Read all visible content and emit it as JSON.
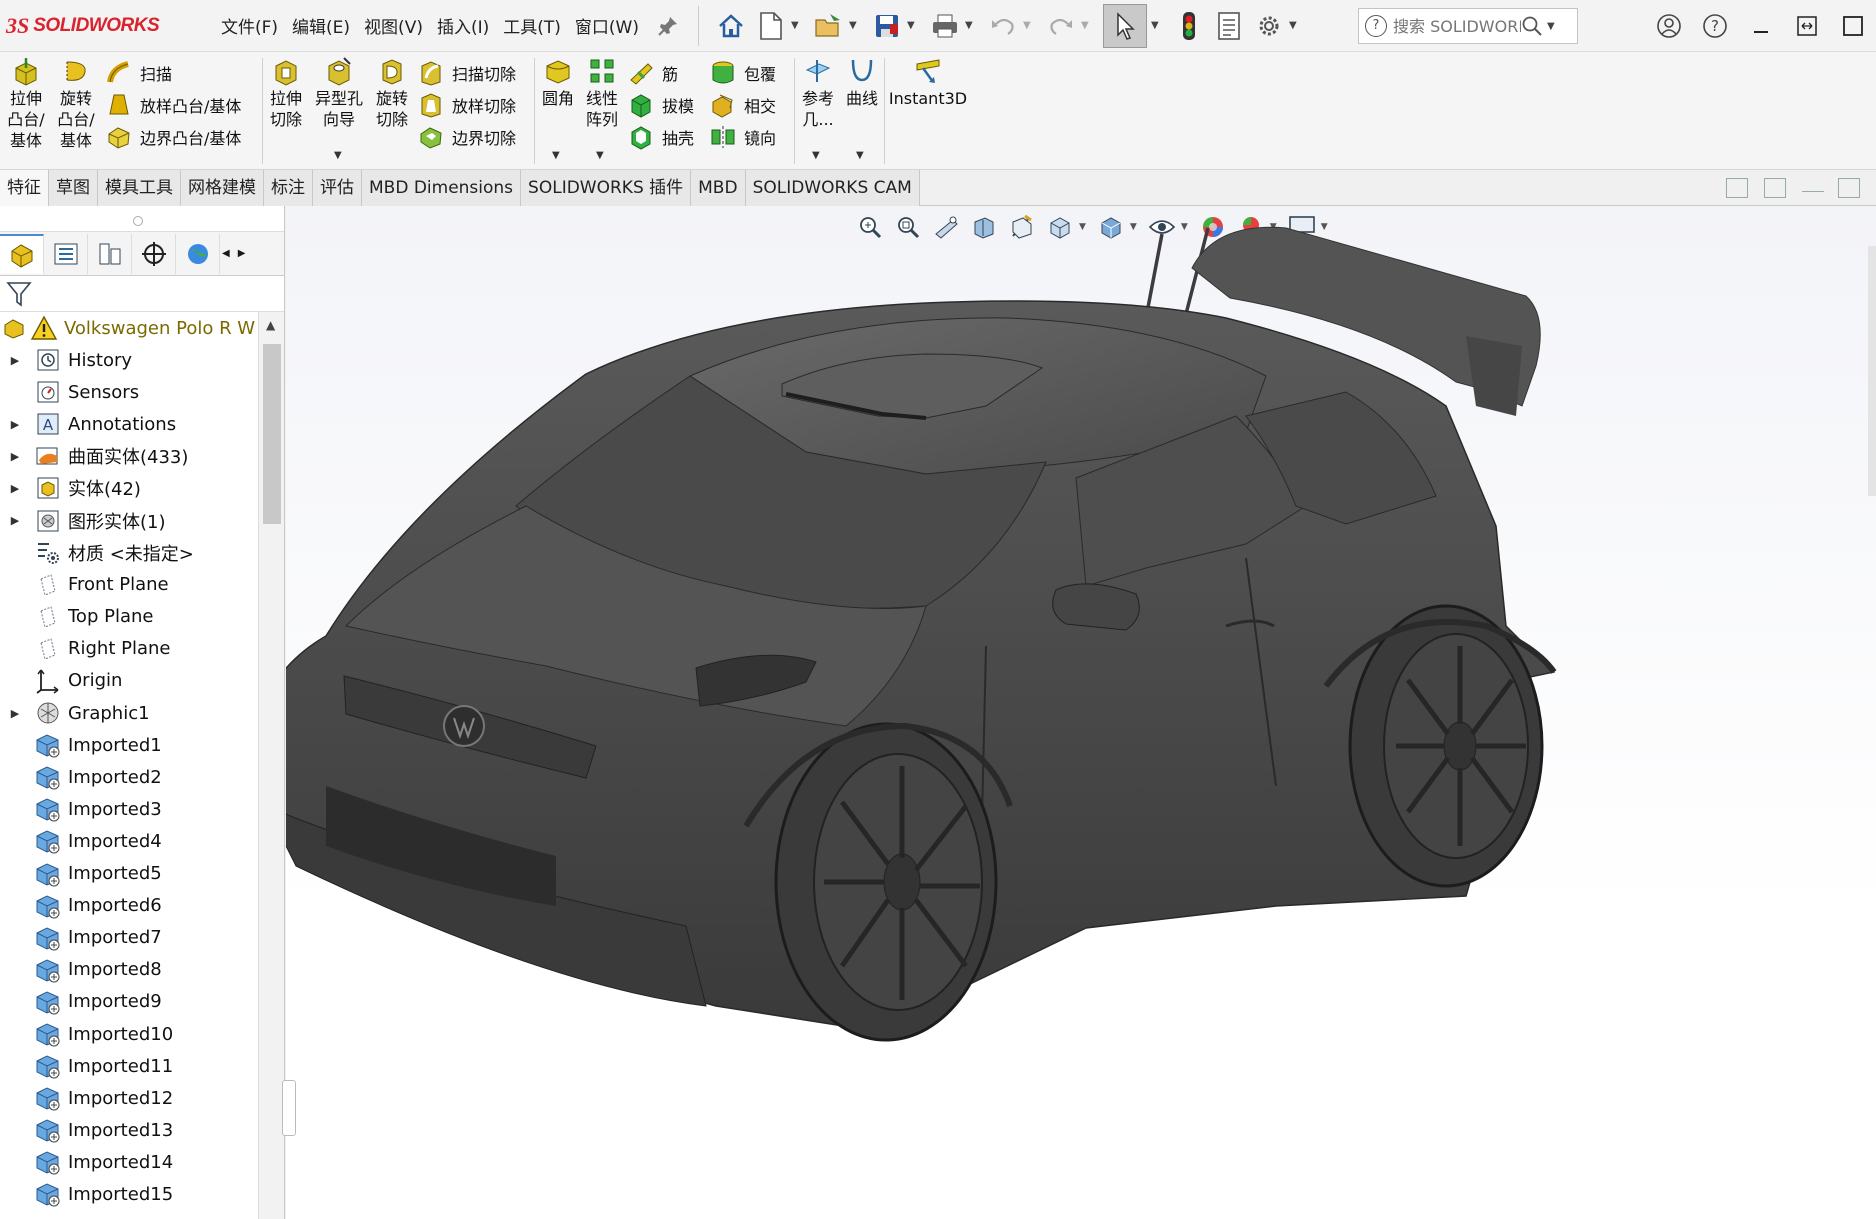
{
  "app": {
    "logo_mark": "3S",
    "brand": "SOLIDWORKS",
    "menus": [
      "文件(F)",
      "编辑(E)",
      "视图(V)",
      "插入(I)",
      "工具(T)",
      "窗口(W)"
    ],
    "search_placeholder": "搜索 SOLIDWORKS",
    "accent_color": "#d9232d"
  },
  "ribbon": {
    "extrude": [
      "拉伸",
      "凸台/",
      "基体"
    ],
    "revolve": [
      "旋转",
      "凸台/",
      "基体"
    ],
    "sweep": "扫描",
    "loft": "放样凸台/基体",
    "boundary": "边界凸台/基体",
    "extrude_cut": [
      "拉伸",
      "切除"
    ],
    "hole_wizard": [
      "异型孔",
      "向导"
    ],
    "revolve_cut": [
      "旋转",
      "切除"
    ],
    "sweep_cut": "扫描切除",
    "loft_cut": "放样切除",
    "boundary_cut": "边界切除",
    "fillet": "圆角",
    "pattern": [
      "线性",
      "阵列"
    ],
    "rib": "筋",
    "draft": "拔模",
    "shell": "抽壳",
    "wrap": "包覆",
    "intersect": "相交",
    "mirror": "镜向",
    "ref_geom": [
      "参考",
      "几..."
    ],
    "curves": "曲线",
    "instant3d": "Instant3D"
  },
  "command_tabs": [
    "特征",
    "草图",
    "模具工具",
    "网格建模",
    "标注",
    "评估",
    "MBD Dimensions",
    "SOLIDWORKS 插件",
    "MBD",
    "SOLIDWORKS CAM"
  ],
  "tree": {
    "root": "Volkswagen Polo R W",
    "items": [
      {
        "label": "History",
        "icon": "history-icon",
        "expandable": true
      },
      {
        "label": "Sensors",
        "icon": "sensors-icon",
        "expandable": false
      },
      {
        "label": "Annotations",
        "icon": "annotations-icon",
        "expandable": true
      },
      {
        "label": "曲面实体(433)",
        "icon": "surface-bodies-icon",
        "expandable": true
      },
      {
        "label": "实体(42)",
        "icon": "solid-bodies-icon",
        "expandable": true
      },
      {
        "label": "图形实体(1)",
        "icon": "graphic-bodies-icon",
        "expandable": true
      },
      {
        "label": "材质 <未指定>",
        "icon": "material-icon",
        "expandable": false
      },
      {
        "label": "Front Plane",
        "icon": "plane-icon",
        "expandable": false
      },
      {
        "label": "Top Plane",
        "icon": "plane-icon",
        "expandable": false
      },
      {
        "label": "Right Plane",
        "icon": "plane-icon",
        "expandable": false
      },
      {
        "label": "Origin",
        "icon": "origin-icon",
        "expandable": false
      },
      {
        "label": "Graphic1",
        "icon": "graphic-body-icon",
        "expandable": true
      },
      {
        "label": "Imported1",
        "icon": "imported-body-icon",
        "expandable": false
      },
      {
        "label": "Imported2",
        "icon": "imported-body-icon",
        "expandable": false
      },
      {
        "label": "Imported3",
        "icon": "imported-body-icon",
        "expandable": false
      },
      {
        "label": "Imported4",
        "icon": "imported-body-icon",
        "expandable": false
      },
      {
        "label": "Imported5",
        "icon": "imported-body-icon",
        "expandable": false
      },
      {
        "label": "Imported6",
        "icon": "imported-body-icon",
        "expandable": false
      },
      {
        "label": "Imported7",
        "icon": "imported-body-icon",
        "expandable": false
      },
      {
        "label": "Imported8",
        "icon": "imported-body-icon",
        "expandable": false
      },
      {
        "label": "Imported9",
        "icon": "imported-body-icon",
        "expandable": false
      },
      {
        "label": "Imported10",
        "icon": "imported-body-icon",
        "expandable": false
      },
      {
        "label": "Imported11",
        "icon": "imported-body-icon",
        "expandable": false
      },
      {
        "label": "Imported12",
        "icon": "imported-body-icon",
        "expandable": false
      },
      {
        "label": "Imported13",
        "icon": "imported-body-icon",
        "expandable": false
      },
      {
        "label": "Imported14",
        "icon": "imported-body-icon",
        "expandable": false
      },
      {
        "label": "Imported15",
        "icon": "imported-body-icon",
        "expandable": false
      }
    ]
  }
}
